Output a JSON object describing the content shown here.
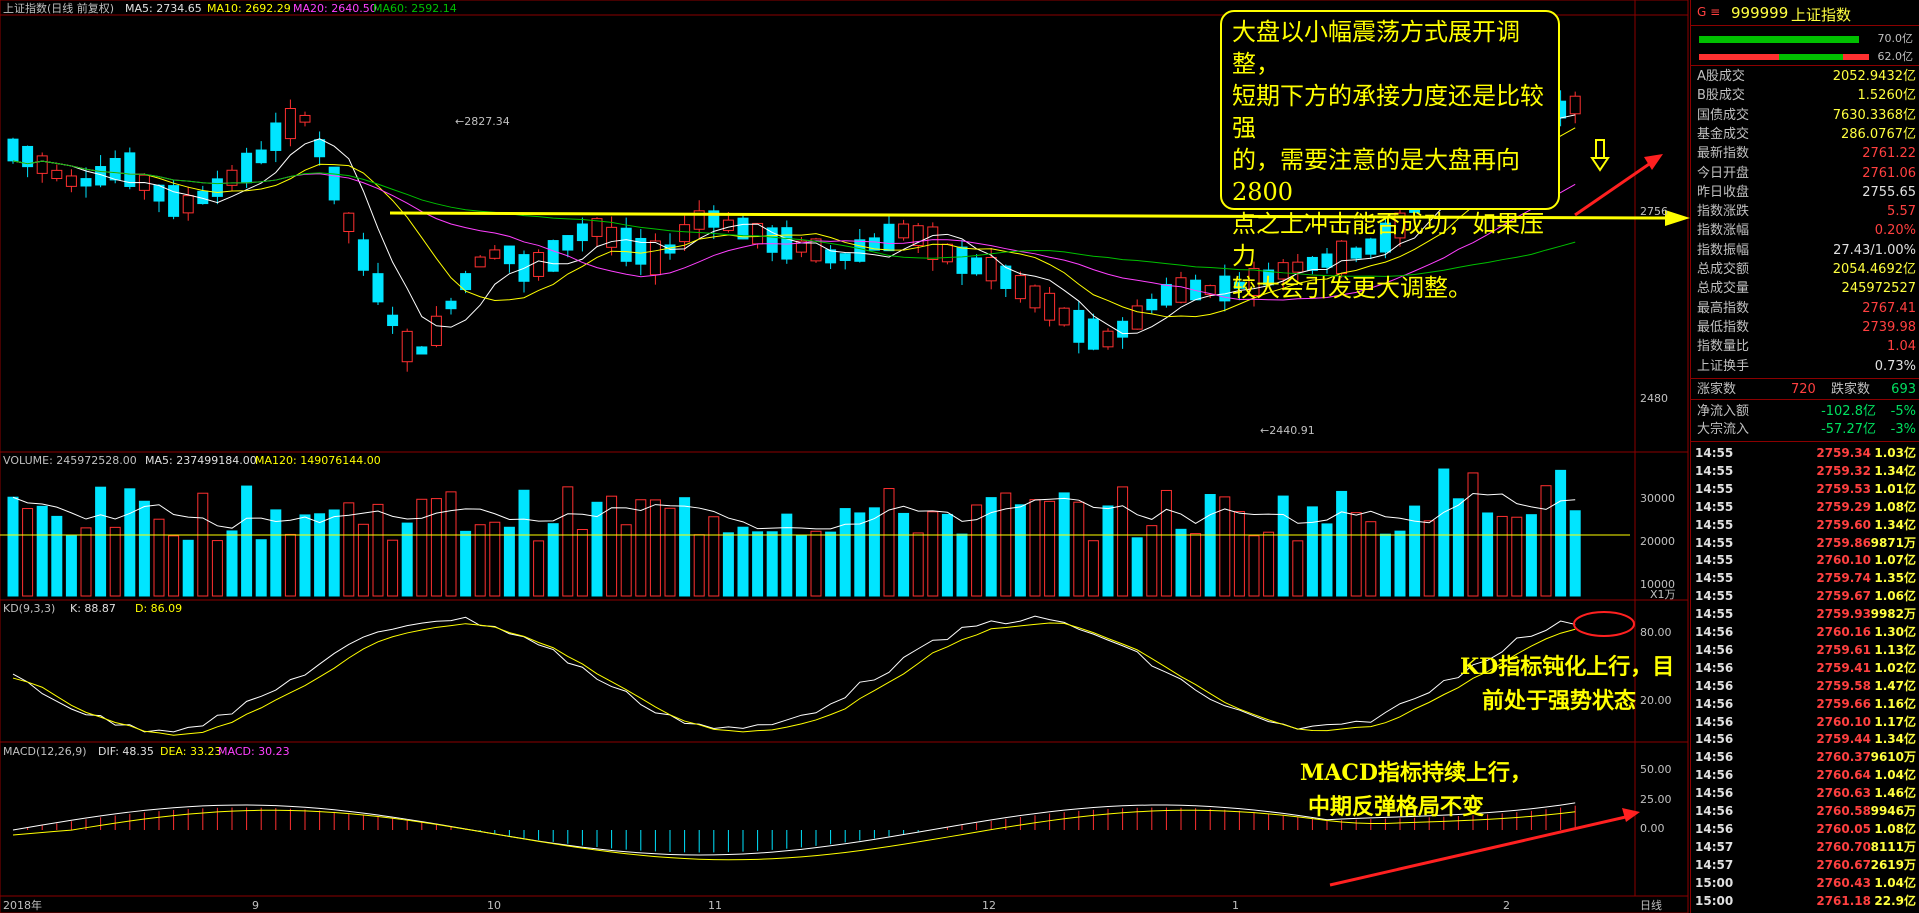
{
  "header": {
    "title": "上证指数(日线 前复权)",
    "ma5_label": "MA5: 2734.65",
    "ma10_label": "MA10: 2692.29",
    "ma20_label": "MA20: 2640.50",
    "ma60_label": "MA60: 2592.14"
  },
  "price_axis": {
    "upper": "2756",
    "lower": "2480"
  },
  "price_marks": {
    "high": "2827.34",
    "low": "2440.91"
  },
  "volume_header": {
    "title": "VOLUME: 245972528.00",
    "ma5": "MA5: 237499184.00",
    "ma120": "MA120: 149076144.00"
  },
  "volume_axis": [
    "30000",
    "20000",
    "10000"
  ],
  "volume_unit": "X1万",
  "kd_header": {
    "title": "KD(9,3,3)",
    "k": "K: 88.87",
    "d": "D: 86.09"
  },
  "kd_axis": [
    "80.00",
    "20.00"
  ],
  "macd_header": {
    "title": "MACD(12,26,9)",
    "dif": "DIF: 48.35",
    "dea": "DEA: 33.23",
    "macd": "MACD: 30.23"
  },
  "macd_axis": [
    "50.00",
    "25.00",
    "0.00"
  ],
  "date_axis": {
    "start": "2018年",
    "m9": "9",
    "m10": "10",
    "m11": "11",
    "m12": "12",
    "m1": "1",
    "m2": "2",
    "period": "日线"
  },
  "annotations": {
    "main_box": [
      "大盘以小幅震荡方式展开调整，",
      "短期下方的承接力度还是比较强",
      "的，需要注意的是大盘再向2800",
      "点之上冲击能否成功，如果压力",
      "较大会引发更大调整。"
    ],
    "kd_note": [
      "KD指标钝化上行，目",
      "前处于强势状态"
    ],
    "macd_note": [
      "MACD指标持续上行，",
      "中期反弹格局不变"
    ]
  },
  "sidebar": {
    "code": "999999",
    "name": "上证指数",
    "bar_top_val": "70.0亿",
    "bar_bot_val": "62.0亿",
    "stats": [
      {
        "label": "A股成交",
        "value": "2052.9432亿",
        "color": "#ffff40"
      },
      {
        "label": "B股成交",
        "value": "1.5260亿",
        "color": "#ffff40"
      },
      {
        "label": "国债成交",
        "value": "7630.3368亿",
        "color": "#ffff40"
      },
      {
        "label": "基金成交",
        "value": "286.0767亿",
        "color": "#ffff40"
      },
      {
        "label": "最新指数",
        "value": "2761.22",
        "color": "#ff4040"
      },
      {
        "label": "今日开盘",
        "value": "2761.06",
        "color": "#ff4040"
      },
      {
        "label": "昨日收盘",
        "value": "2755.65",
        "color": "#e0e0e0"
      },
      {
        "label": "指数涨跌",
        "value": "5.57",
        "color": "#ff4040"
      },
      {
        "label": "指数涨幅",
        "value": "0.20%",
        "color": "#ff4040"
      },
      {
        "label": "指数振幅",
        "value": "27.43/1.00%",
        "color": "#e0e0e0"
      },
      {
        "label": "总成交额",
        "value": "2054.4692亿",
        "color": "#ffff40"
      },
      {
        "label": "总成交量",
        "value": "245972527",
        "color": "#ffff40"
      },
      {
        "label": "最高指数",
        "value": "2767.41",
        "color": "#ff4040"
      },
      {
        "label": "最低指数",
        "value": "2739.98",
        "color": "#ff4040"
      },
      {
        "label": "指数量比",
        "value": "1.04",
        "color": "#ff4040"
      },
      {
        "label": "上证换手",
        "value": "0.73%",
        "color": "#e0e0e0"
      }
    ],
    "up_label": "涨家数",
    "up_value": "720",
    "down_label": "跌家数",
    "down_value": "693",
    "flows": [
      {
        "label": "净流入额",
        "value": "-102.8亿",
        "pct": "-5%"
      },
      {
        "label": "大宗流入",
        "value": "-57.27亿",
        "pct": "-3%"
      }
    ],
    "ticks": [
      [
        "14:55",
        "2759.34",
        "1.03亿"
      ],
      [
        "14:55",
        "2759.32",
        "1.34亿"
      ],
      [
        "14:55",
        "2759.53",
        "1.01亿"
      ],
      [
        "14:55",
        "2759.29",
        "1.08亿"
      ],
      [
        "14:55",
        "2759.60",
        "1.34亿"
      ],
      [
        "14:55",
        "2759.86",
        "9871万"
      ],
      [
        "14:55",
        "2760.10",
        "1.07亿"
      ],
      [
        "14:55",
        "2759.74",
        "1.35亿"
      ],
      [
        "14:55",
        "2759.67",
        "1.06亿"
      ],
      [
        "14:55",
        "2759.93",
        "9982万"
      ],
      [
        "14:56",
        "2760.16",
        "1.30亿"
      ],
      [
        "14:56",
        "2759.61",
        "1.13亿"
      ],
      [
        "14:56",
        "2759.41",
        "1.02亿"
      ],
      [
        "14:56",
        "2759.58",
        "1.47亿"
      ],
      [
        "14:56",
        "2759.66",
        "1.16亿"
      ],
      [
        "14:56",
        "2760.10",
        "1.17亿"
      ],
      [
        "14:56",
        "2759.44",
        "1.34亿"
      ],
      [
        "14:56",
        "2760.37",
        "9610万"
      ],
      [
        "14:56",
        "2760.64",
        "1.04亿"
      ],
      [
        "14:56",
        "2760.63",
        "1.46亿"
      ],
      [
        "14:56",
        "2760.58",
        "9946万"
      ],
      [
        "14:56",
        "2760.05",
        "1.08亿"
      ],
      [
        "14:57",
        "2760.70",
        "8111万"
      ],
      [
        "14:57",
        "2760.67",
        "2619万"
      ],
      [
        "15:00",
        "2760.43",
        "1.04亿"
      ],
      [
        "15:00",
        "2761.18",
        "22.9亿"
      ]
    ]
  },
  "colors": {
    "up": "#ff3030",
    "down": "#00e5ff",
    "ma5": "#ffffff",
    "ma10": "#ffff00",
    "ma20": "#ff40ff",
    "ma60": "#00c000",
    "frame": "#8b0000"
  }
}
